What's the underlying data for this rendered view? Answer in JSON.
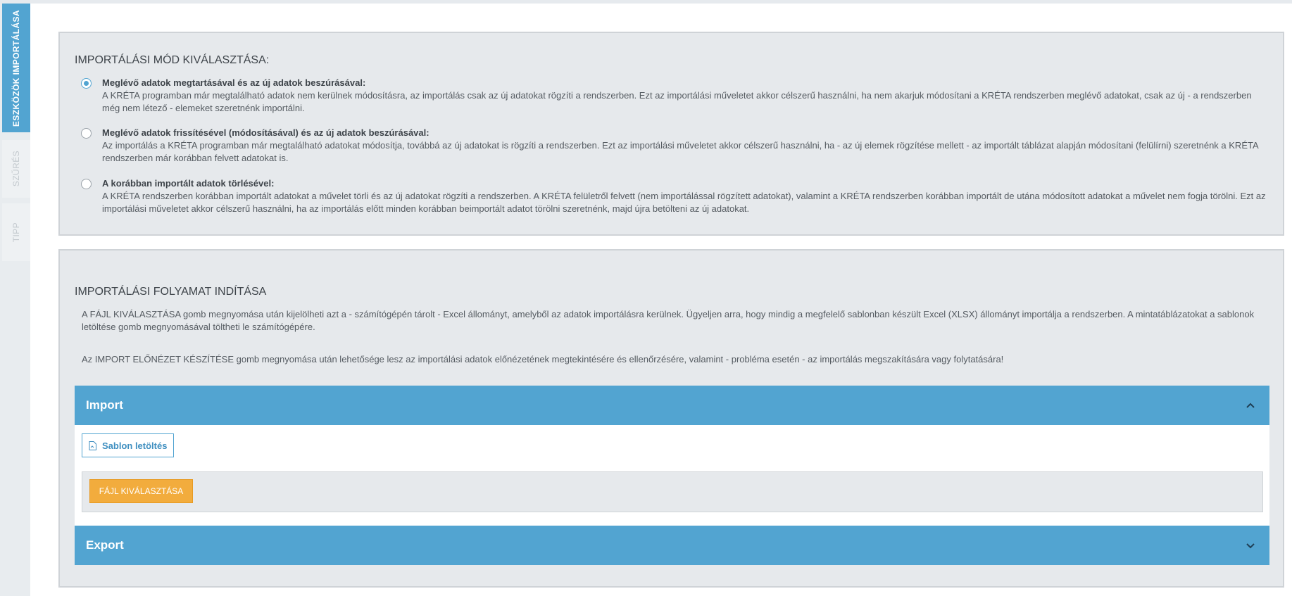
{
  "sidebar": {
    "tabs": [
      {
        "label": "ESZKÖZÖK IMPORTÁLÁSA",
        "active": true
      },
      {
        "label": "SZŰRÉS",
        "active": false
      },
      {
        "label": "TIPP",
        "active": false
      }
    ]
  },
  "mode_panel": {
    "title": "IMPORTÁLÁSI MÓD KIVÁLASZTÁSA:",
    "options": [
      {
        "title": "Meglévő adatok megtartásával és az új adatok beszúrásával:",
        "description": "A KRÉTA programban már megtalálható adatok nem kerülnek módosításra, az importálás csak az új adatokat rögzíti a rendszerben. Ezt az importálási műveletet akkor célszerű használni, ha nem akarjuk módosítani a KRÉTA rendszerben meglévő adatokat, csak az új - a rendszerben még nem létező - elemeket szeretnénk importálni.",
        "selected": true
      },
      {
        "title": "Meglévő adatok frissítésével (módosításával) és az új adatok beszúrásával:",
        "description": "Az importálás a KRÉTA programban már megtalálható adatokat módosítja, továbbá az új adatokat is rögzíti a rendszerben. Ezt az importálási műveletet akkor célszerű használni, ha - az új elemek rögzítése mellett - az importált táblázat alapján módosítani (felülírni) szeretnénk a KRÉTA rendszerben már korábban felvett adatokat is.",
        "selected": false
      },
      {
        "title": "A korábban importált adatok törlésével:",
        "description": "A KRÉTA rendszerben korábban importált adatokat a művelet törli és az új adatokat rögzíti a rendszerben. A KRÉTA felületről felvett (nem importálással rögzített adatokat), valamint a KRÉTA rendszerben korábban importált de utána módosított adatokat a művelet nem fogja törölni. Ezt az importálási műveletet akkor célszerű használni, ha az importálás előtt minden korábban beimportált adatot törölni szeretnénk, majd újra betölteni az új adatokat.",
        "selected": false
      }
    ]
  },
  "run_panel": {
    "title": "IMPORTÁLÁSI FOLYAMAT INDÍTÁSA",
    "paragraph1": "A FÁJL KIVÁLASZTÁSA gomb megnyomása után kijelölheti azt a - számítógépén tárolt - Excel állományt, amelyből az adatok importálásra kerülnek. Ügyeljen arra, hogy mindig a megfelelő sablonban készült Excel (XLSX) állományt importálja a rendszerben. A mintatáblázatokat a sablonok letöltése gomb megnyomásával töltheti le számítógépére.",
    "paragraph2": "Az IMPORT ELŐNÉZET KÉSZÍTÉSE gomb megnyomása után lehetősége lesz az importálási adatok előnézetének megtekintésére és ellenőrzésére, valamint - probléma esetén - az importálás megszakítására vagy folytatására!",
    "import_section": {
      "title": "Import",
      "template_button": "Sablon letöltés",
      "file_button": "FÁJL KIVÁLASZTÁSA"
    },
    "export_section": {
      "title": "Export"
    }
  },
  "colors": {
    "accent": "#52a4d1",
    "file_button": "#f2ac3d",
    "panel_bg": "#e6e9ec"
  },
  "icons": {
    "import_chevron": "chevron-up-icon",
    "export_chevron": "chevron-down-icon",
    "template": "file-icon"
  }
}
